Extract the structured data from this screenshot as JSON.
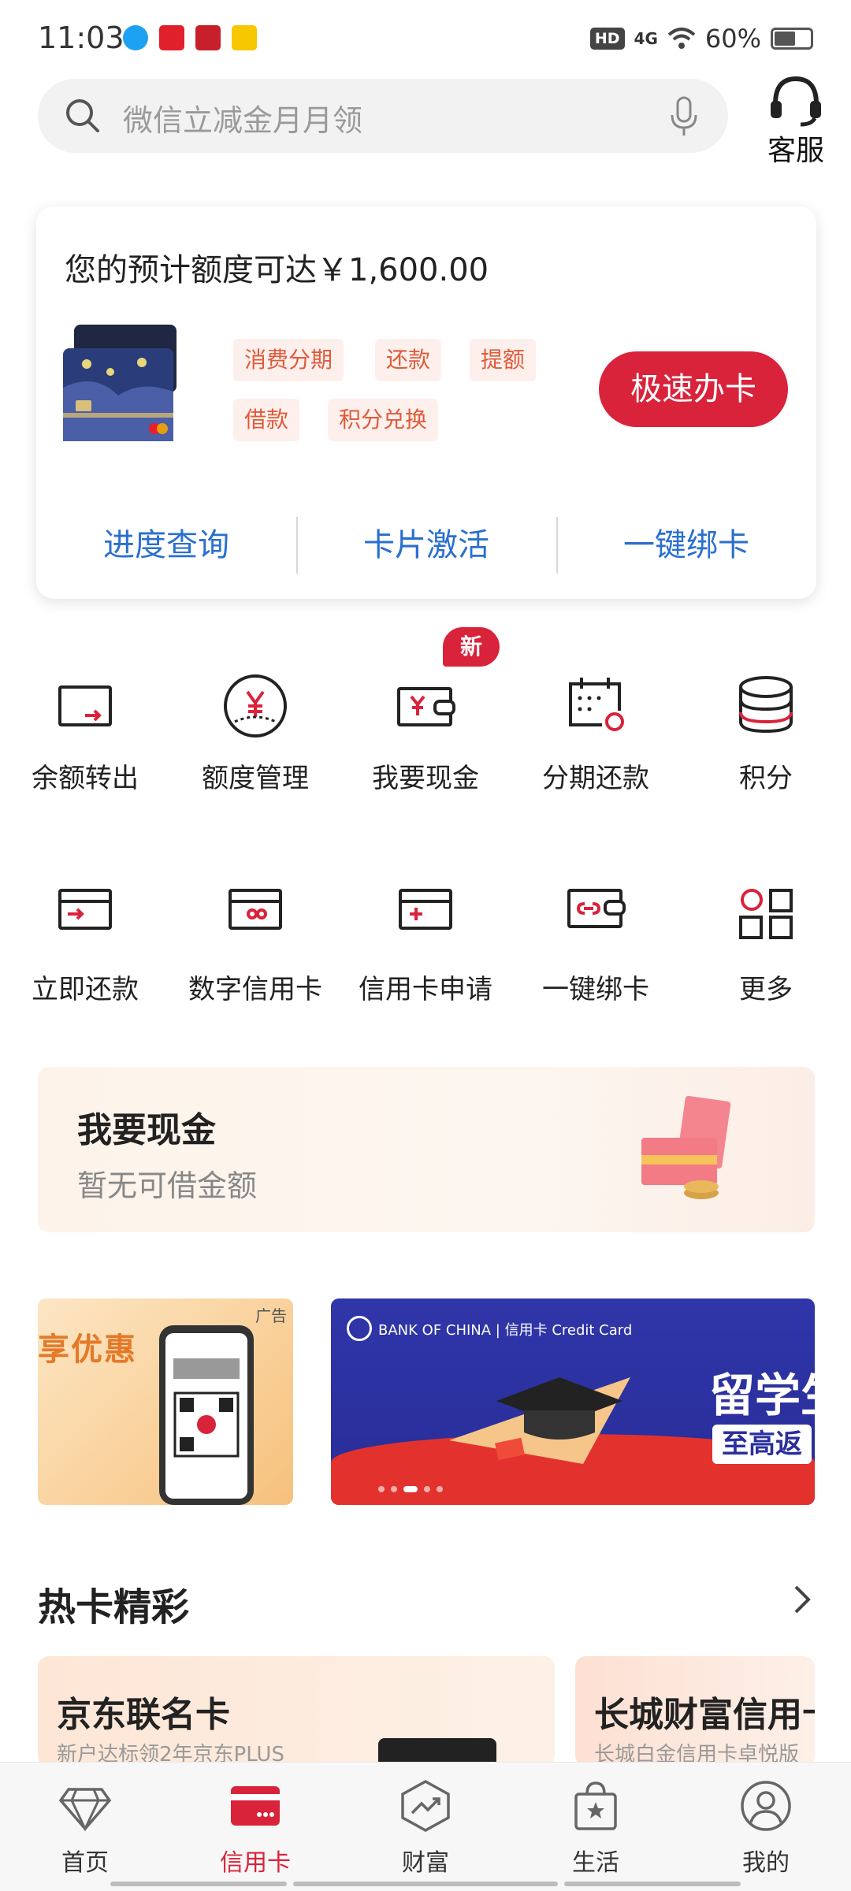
{
  "status_bar": {
    "time": "11:03",
    "hd": "HD",
    "network": "4G",
    "battery": "60%",
    "battery_level": 0.6
  },
  "search": {
    "placeholder": "微信立减金月月领"
  },
  "service": {
    "label": "客服"
  },
  "card": {
    "limit_text": "您的预计额度可达￥1,600.00",
    "tags": [
      "消费分期",
      "还款",
      "提额",
      "借款",
      "积分兑换"
    ],
    "apply_label": "极速办卡",
    "actions": [
      "进度查询",
      "卡片激活",
      "一键绑卡"
    ]
  },
  "grid_row1": [
    "余额转出",
    "额度管理",
    "我要现金",
    "分期还款",
    "积分"
  ],
  "grid_row2": [
    "立即还款",
    "数字信用卡",
    "信用卡申请",
    "一键绑卡",
    "更多"
  ],
  "new_badge": "新",
  "cash": {
    "title": "我要现金",
    "subtitle": "暂无可借金额"
  },
  "ads": {
    "left_text": "享优惠",
    "left_tag": "广告",
    "main_logo": "BANK OF CHINA | 信用卡 Credit Card",
    "main_headline": "留学生",
    "main_sub": "至高返"
  },
  "hot": {
    "title": "热卡精彩",
    "cards": [
      {
        "name": "京东联名卡",
        "desc": "新户达标领2年京东PLUS"
      },
      {
        "name": "长城财富信用卡",
        "desc": "长城白金信用卡卓悦版"
      }
    ]
  },
  "tabs": [
    "首页",
    "信用卡",
    "财富",
    "生活",
    "我的"
  ],
  "colors": {
    "brand_red": "#d9233b",
    "link_blue": "#2a6fcf",
    "tag_bg": "#fdf0ec",
    "tag_text": "#e05a3a"
  }
}
